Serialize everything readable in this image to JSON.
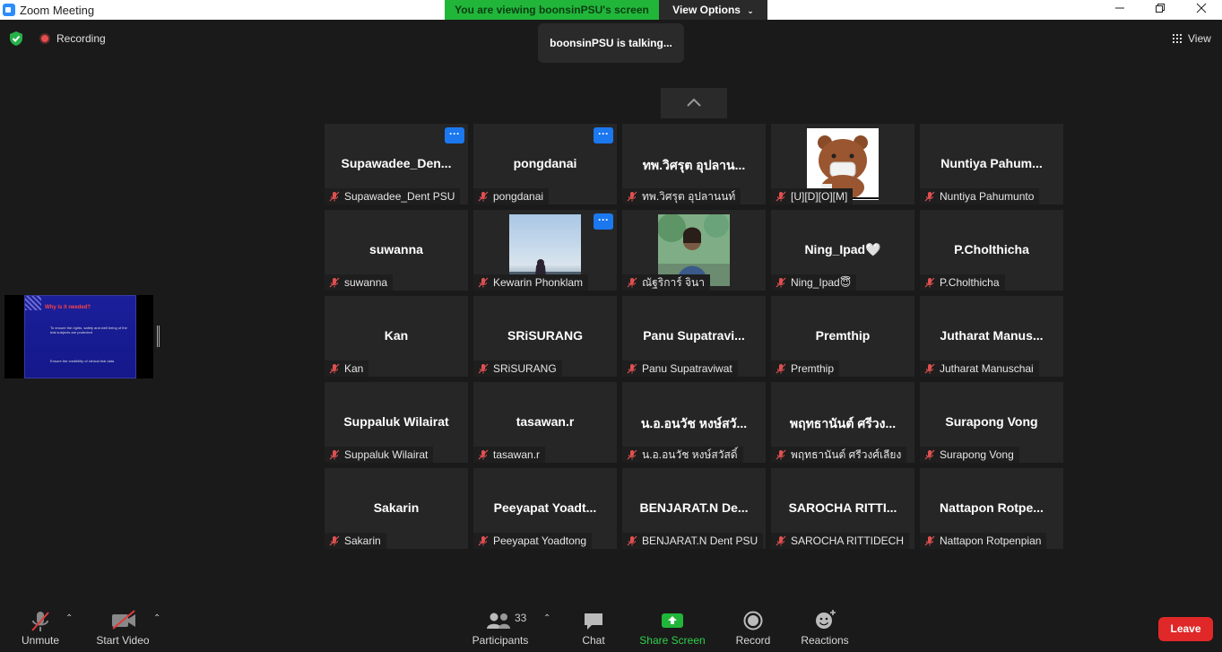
{
  "window": {
    "title": "Zoom Meeting"
  },
  "banner": {
    "viewing": "You are viewing boonsinPSU's screen",
    "view_options": "View Options"
  },
  "talking": "boonsinPSU is talking...",
  "recording": {
    "label": "Recording"
  },
  "view_button": "View",
  "shared_slide": {
    "title": "Why is it needed?",
    "bullet1": "To ensure the rights, safety and well being of the trial subjects are protected",
    "bullet2": "Ensure the credibility of clinical trial data"
  },
  "tiles": [
    {
      "name": "Supawadee_Den...",
      "label": "Supawadee_Dent PSU",
      "more": true
    },
    {
      "name": "pongdanai",
      "label": "pongdanai",
      "more": true
    },
    {
      "name": "ทพ.วิศรุต อุปลาน...",
      "label": "ทพ.วิศรุต อุปลานนท์"
    },
    {
      "name": "",
      "label": "[U][D][O][M]",
      "photo": "bear"
    },
    {
      "name": "Nuntiya  Pahum...",
      "label": "Nuntiya Pahumunto"
    },
    {
      "name": "suwanna",
      "label": "suwanna"
    },
    {
      "name": "",
      "label": "Kewarin Phonklam",
      "more": true,
      "photo": "sky"
    },
    {
      "name": "",
      "label": "ณัฐริการ์ จินา",
      "photo": "person"
    },
    {
      "name": "Ning_Ipad🤍",
      "label": "Ning_Ipad😇"
    },
    {
      "name": "P.Cholthicha",
      "label": "P.Cholthicha"
    },
    {
      "name": "Kan",
      "label": "Kan"
    },
    {
      "name": "SRiSURANG",
      "label": "SRiSURANG"
    },
    {
      "name": "Panu  Supatravi...",
      "label": "Panu Supatraviwat"
    },
    {
      "name": "Premthip",
      "label": "Premthip"
    },
    {
      "name": "Jutharat  Manus...",
      "label": "Jutharat Manuschai"
    },
    {
      "name": "Suppaluk Wilairat",
      "label": "Suppaluk Wilairat"
    },
    {
      "name": "tasawan.r",
      "label": "tasawan.r"
    },
    {
      "name": "น.อ.อนวัช หงษ์สวั...",
      "label": "น.อ.อนวัช หงษ์สวัสดิ์"
    },
    {
      "name": "พฤทธานันต์ ศรีวง...",
      "label": "พฤทธานันต์ ศรีวงศ์เลียง"
    },
    {
      "name": "Surapong Vong",
      "label": "Surapong Vong"
    },
    {
      "name": "Sakarin",
      "label": "Sakarin"
    },
    {
      "name": "Peeyapat   Yoadt...",
      "label": "Peeyapat  Yoadtong"
    },
    {
      "name": "BENJARAT.N De...",
      "label": "BENJARAT.N Dent PSU"
    },
    {
      "name": "SAROCHA  RITTI...",
      "label": "SAROCHA RITTIDECH"
    },
    {
      "name": "Nattapon  Rotpe...",
      "label": "Nattapon Rotpenpian"
    }
  ],
  "toolbar": {
    "unmute": "Unmute",
    "start_video": "Start Video",
    "participants": "Participants",
    "participants_count": "33",
    "chat": "Chat",
    "share_screen": "Share Screen",
    "record": "Record",
    "reactions": "Reactions",
    "leave": "Leave"
  },
  "colors": {
    "share_green": "#21b63a",
    "leave_red": "#e02828",
    "more_blue": "#1b78ef"
  }
}
